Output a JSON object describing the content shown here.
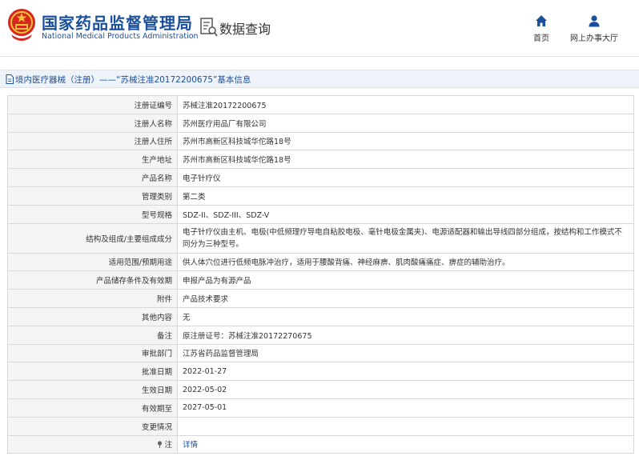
{
  "header": {
    "brand_cn": "国家药品监督管理局",
    "brand_en": "National Medical Products Administration",
    "query_title": "数据查询",
    "nav": [
      {
        "label": "首页",
        "icon": "home-icon"
      },
      {
        "label": "网上办事大厅",
        "icon": "user-icon"
      }
    ]
  },
  "titlebar": {
    "text": "境内医疗器械（注册）——“苏械注准20172200675”基本信息",
    "icon": "document-icon"
  },
  "rows": [
    {
      "label": "注册证编号",
      "value": "苏械注准20172200675"
    },
    {
      "label": "注册人名称",
      "value": "苏州医疗用品厂有限公司"
    },
    {
      "label": "注册人住所",
      "value": "苏州市高新区科技城华佗路18号"
    },
    {
      "label": "生产地址",
      "value": "苏州市高新区科技城华佗路18号"
    },
    {
      "label": "产品名称",
      "value": "电子针疗仪"
    },
    {
      "label": "管理类别",
      "value": "第二类"
    },
    {
      "label": "型号规格",
      "value": "SDZ-II、SDZ-III、SDZ-V"
    },
    {
      "label": "结构及组成/主要组成成分",
      "value": "电子针疗仪由主机、电极(中低频理疗导电自粘胶电极、毫针电极金属夹)、电源适配器和输出导线四部分组成，按结构和工作模式不同分为三种型号。"
    },
    {
      "label": "适用范围/预期用途",
      "value": "供人体穴位进行低频电脉冲治疗，适用于腰酸背痛、神经麻痹、肌肉酸痛痛症、痹症的辅助治疗。"
    },
    {
      "label": "产品储存条件及有效期",
      "value": "申报产品为有源产品"
    },
    {
      "label": "附件",
      "value": "产品技术要求"
    },
    {
      "label": "其他内容",
      "value": "无"
    },
    {
      "label": "备注",
      "value": "原注册证号：苏械注准20172270675"
    },
    {
      "label": "审批部门",
      "value": "江苏省药品监督管理局"
    },
    {
      "label": "批准日期",
      "value": "2022-01-27"
    },
    {
      "label": "生效日期",
      "value": "2022-05-02"
    },
    {
      "label": "有效期至",
      "value": "2027-05-01"
    },
    {
      "label": "变更情况",
      "value": ""
    },
    {
      "label": "注",
      "value": "详情",
      "icon": "pin-icon"
    }
  ],
  "colors": {
    "brand": "#1a4f9c",
    "label_bg": "#f4f4f4",
    "border": "#d8d8d8",
    "titlebar_bg": "#eef3fa"
  }
}
